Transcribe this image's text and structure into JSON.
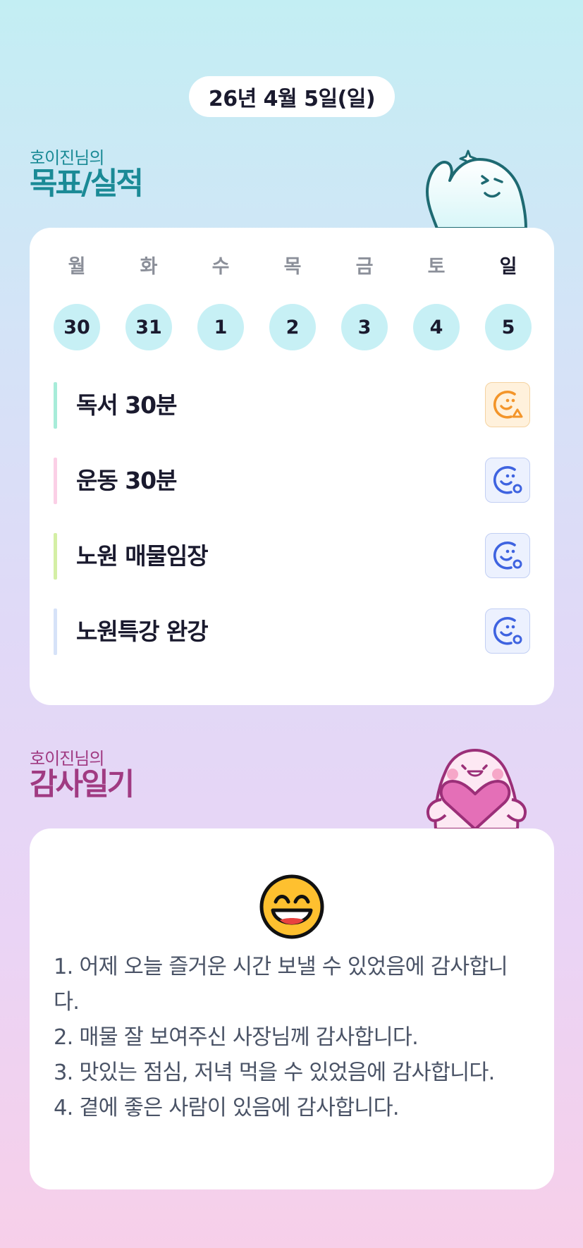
{
  "header": {
    "date": "26년 4월 5일(일)"
  },
  "goal_section": {
    "subtitle": "호이진님의",
    "title": "목표/실적",
    "week": [
      {
        "day": "월",
        "date": "30"
      },
      {
        "day": "화",
        "date": "31"
      },
      {
        "day": "수",
        "date": "1"
      },
      {
        "day": "목",
        "date": "2"
      },
      {
        "day": "금",
        "date": "3"
      },
      {
        "day": "토",
        "date": "4"
      },
      {
        "day": "일",
        "date": "5"
      }
    ],
    "selected_day_index": 6,
    "goals": [
      {
        "label": "독서 30분",
        "bar_color": "#a7ecd9",
        "status": "partial",
        "status_icon": "smile-triangle-icon",
        "status_color": "#f3952a"
      },
      {
        "label": "운동 30분",
        "bar_color": "#fbcfe6",
        "status": "done",
        "status_icon": "smile-circle-icon",
        "status_color": "#3e63e0"
      },
      {
        "label": "노원 매물임장",
        "bar_color": "#d4efa5",
        "status": "done",
        "status_icon": "smile-circle-icon",
        "status_color": "#3e63e0"
      },
      {
        "label": "노원특강 완강",
        "bar_color": "#d6e2f8",
        "status": "done",
        "status_icon": "smile-circle-icon",
        "status_color": "#3e63e0"
      }
    ]
  },
  "gratitude_section": {
    "subtitle": "호이진님의",
    "title": "감사일기",
    "mood_icon": "grinning-face-icon",
    "entries": [
      "1. 어제 오늘 즐거운 시간 보낼 수 있었음에 감사합니다.",
      "2. 매물 잘 보여주신 사장님께 감사합니다.",
      "3. 맛있는 점심, 저녁 먹을 수 있었음에 감사합니다.",
      "4. 곁에 좋은 사람이 있음에 감사합니다."
    ]
  },
  "colors": {
    "goal_accent": "#1a8a96",
    "gratitude_accent": "#a03a82",
    "date_circle": "#c7f0f5"
  }
}
